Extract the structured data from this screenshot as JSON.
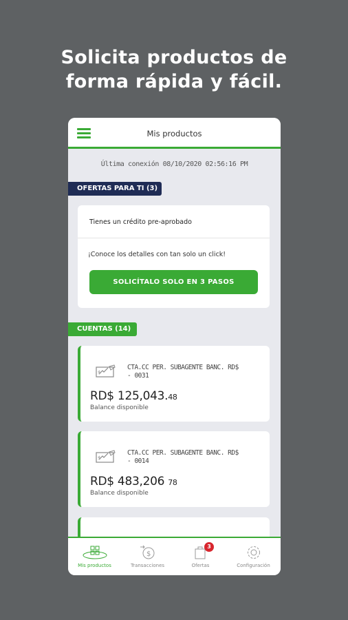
{
  "headline": {
    "line1": "Solicita productos de",
    "line2": "forma rápida y fácil."
  },
  "appbar": {
    "title": "Mis productos"
  },
  "last_connection": "Última conexión 08/10/2020  02:56:16 PM",
  "offers": {
    "tag": "OFERTAS PARA TI (3)",
    "title": "Tienes un crédito pre-aprobado",
    "description": "¡Conoce los detalles con tan solo un click!",
    "button": "SOLICÍTALO SOLO EN 3 PASOS"
  },
  "accounts": {
    "tag": "CUENTAS (14)",
    "items": [
      {
        "name_line1": "CTA.CC PER. SUBAGENTE BANC. RD$",
        "name_line2": "- 0031",
        "balance_main": "RD$ 125,043.",
        "balance_cents": "48",
        "balance_label": "Balance disponible"
      },
      {
        "name_line1": "CTA.CC PER. SUBAGENTE BANC. RD$",
        "name_line2": "- 0014",
        "balance_main": "RD$ 483,206 ",
        "balance_cents": "78",
        "balance_label": "Balance disponible"
      }
    ]
  },
  "bottom_nav": [
    {
      "label": "Mis productos",
      "icon": "products-icon",
      "active": true
    },
    {
      "label": "Transacciones",
      "icon": "transactions-icon",
      "active": false
    },
    {
      "label": "Ofertas",
      "icon": "offers-icon",
      "active": false,
      "badge": "3"
    },
    {
      "label": "Configuración",
      "icon": "settings-gear-icon",
      "active": false
    }
  ],
  "colors": {
    "green": "#3aaa35",
    "navy": "#1f2c55",
    "background": "#5e6163",
    "badge": "#d8262e"
  }
}
